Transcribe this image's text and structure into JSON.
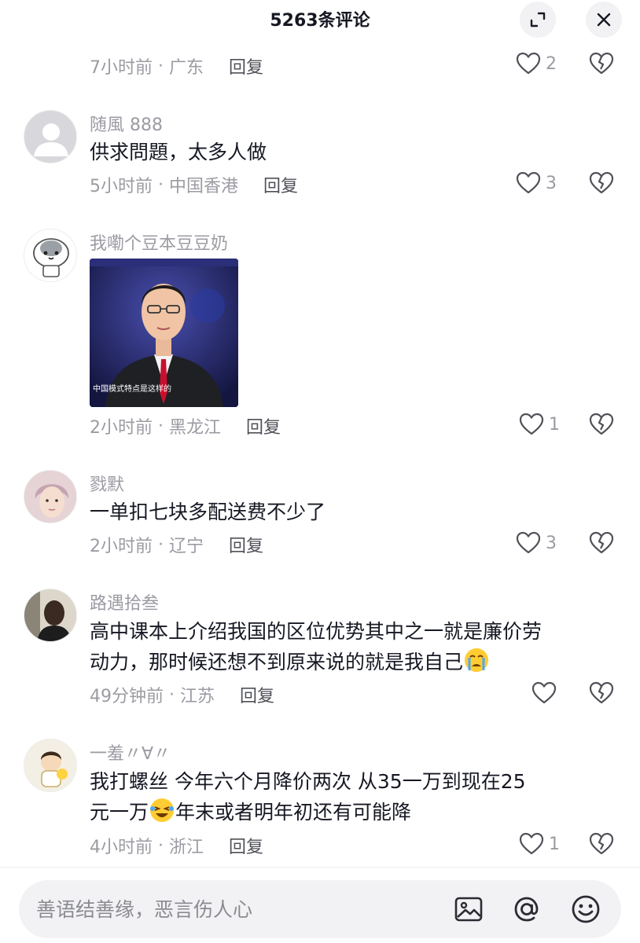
{
  "header": {
    "title": "5263条评论"
  },
  "comments": [
    {
      "time": "7小时前",
      "location": "广东",
      "reply": "回复",
      "likes": "2"
    },
    {
      "author": "随風 888",
      "text": "供求問題，太多人做",
      "time": "5小时前",
      "location": "中国香港",
      "reply": "回复",
      "likes": "3"
    },
    {
      "author": "我嘞个豆本豆豆奶",
      "image_caption": "中国模式特点是这样的",
      "time": "2小时前",
      "location": "黑龙江",
      "reply": "回复",
      "likes": "1"
    },
    {
      "author": "戮默",
      "text": "一单扣七块多配送费不少了",
      "time": "2小时前",
      "location": "辽宁",
      "reply": "回复",
      "likes": "3"
    },
    {
      "author": "路遇拾叁",
      "text_line1": "高中课本上介绍我国的区位优势其中之一就是廉价劳",
      "text_line2": "动力，那时候还想不到原来说的就是我自己",
      "time": "49分钟前",
      "location": "江苏",
      "reply": "回复",
      "likes": ""
    },
    {
      "author": "一羞〃∀〃",
      "text_line1": "我打螺丝  今年六个月降价两次   从35一万到现在25",
      "text_line2_a": "元一万",
      "text_line2_b": "年末或者明年初还有可能降",
      "time": "4小时前",
      "location": "浙江",
      "reply": "回复",
      "likes": "1"
    }
  ],
  "input": {
    "placeholder": "善语结善缘，恶言伤人心"
  },
  "icons": [
    "expand-icon",
    "close-icon",
    "heart-icon",
    "broken-heart-icon",
    "image-icon",
    "at-icon",
    "smiley-icon",
    "crying-emoji",
    "laughing-emoji"
  ]
}
